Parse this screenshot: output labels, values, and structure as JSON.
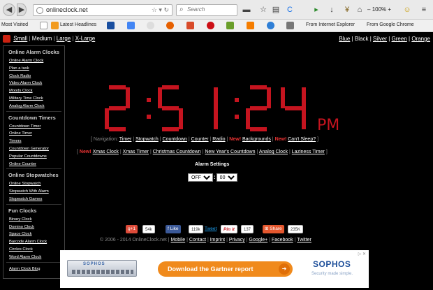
{
  "browser": {
    "url": "onlineclock.net",
    "search_placeholder": "Search",
    "zoom_minus": "–",
    "zoom_level": "100%",
    "zoom_plus": "+",
    "bookmarks": [
      {
        "label": "Most Visited",
        "icon": "globe-icon"
      },
      {
        "label": "",
        "icon": "page-icon"
      },
      {
        "label": "Latest Headlines",
        "icon": "rss-icon"
      },
      {
        "label": "",
        "icon": "s-icon"
      },
      {
        "label": "",
        "icon": "google-icon"
      },
      {
        "label": "",
        "icon": "chrome-icon"
      },
      {
        "label": "",
        "icon": "firefox-icon"
      },
      {
        "label": "",
        "icon": "chart-icon"
      },
      {
        "label": "",
        "icon": "opera-icon"
      },
      {
        "label": "",
        "icon": "tb-icon"
      },
      {
        "label": "",
        "icon": "blogger-icon"
      },
      {
        "label": "",
        "icon": "circle-icon"
      },
      {
        "label": "",
        "icon": "wrench-icon"
      },
      {
        "label": "From Internet Explorer",
        "icon": "folder-icon"
      },
      {
        "label": "From Google Chrome",
        "icon": "folder-icon"
      }
    ]
  },
  "page": {
    "sizes": [
      "Small",
      "Medium",
      "Large",
      "X-Large"
    ],
    "colors": [
      "Blue",
      "Black",
      "Silver",
      "Green",
      "Orange"
    ],
    "sidebar": [
      {
        "title": "Online Alarm Clocks",
        "links": [
          "Online Alarm Clock",
          "Plan a task",
          "Clock Radio",
          "Video Alarm Clock",
          "Moods Clock",
          "Military Time Clock",
          "Analog Alarm Clock"
        ]
      },
      {
        "title": "Countdown Timers",
        "links": [
          "Countdown Timer",
          "Online Timer",
          "Timers",
          "Countdown Generator",
          "Popular Countdowns",
          "Online Counter"
        ]
      },
      {
        "title": "Online Stopwatches",
        "links": [
          "Online Stopwatch",
          "Stopwatch With Alarm",
          "Stopwatch Games"
        ]
      },
      {
        "title": "Fun Clocks",
        "links": [
          "Binary Clock",
          "Domino Clock",
          "Space Clock",
          "Barcode Alarm Clock",
          "Circles Clock",
          "Word Alarm Clock"
        ]
      },
      {
        "title": "",
        "links": [
          "Alarm Clock Blog"
        ]
      }
    ],
    "clock": {
      "time": "2:51:24",
      "ampm": "PM",
      "color": "#c5141f"
    },
    "nav1": {
      "prefix": "[ Navigation:",
      "links": [
        "Timer",
        "Stopwatch",
        "Countdown",
        "Counter",
        "Radio"
      ],
      "new1": "New!",
      "link_new1": "Backgrounds",
      "new2": "New!",
      "link_new2": "Can't Sleep?",
      "suffix": "]"
    },
    "nav2": {
      "prefix": "[",
      "new": "New!",
      "links": [
        "Xmas Clock",
        "Xmas Timer",
        "Christmas Countdown",
        "New Year's Countdown",
        "Analog Clock",
        "Laziness Timer"
      ],
      "suffix": "]"
    },
    "alarm": {
      "title": "Alarm Settings",
      "hour": "OFF",
      "minute": "00",
      "colon": ":"
    },
    "social": {
      "gplus": "g+1",
      "gplus_count": "54k",
      "fb_like": "Like",
      "fb_count": "119k",
      "tweet": "Tweet",
      "pinit": "Pin it",
      "pin_count": "137",
      "share": "Share",
      "share_count": "235K"
    },
    "footer": {
      "copy": "© 2006 - 2014 OnlineClock.net",
      "links": [
        "Mobile",
        "Contact",
        "Imprint",
        "Privacy",
        "Google+",
        "Facebook",
        "Twitter"
      ]
    },
    "ad": {
      "device_brand": "SOPHOS",
      "cta": "Download the Gartner report",
      "logo": "SOPHOS",
      "tagline": "Security made simple.",
      "close": "▷ ✕"
    }
  }
}
